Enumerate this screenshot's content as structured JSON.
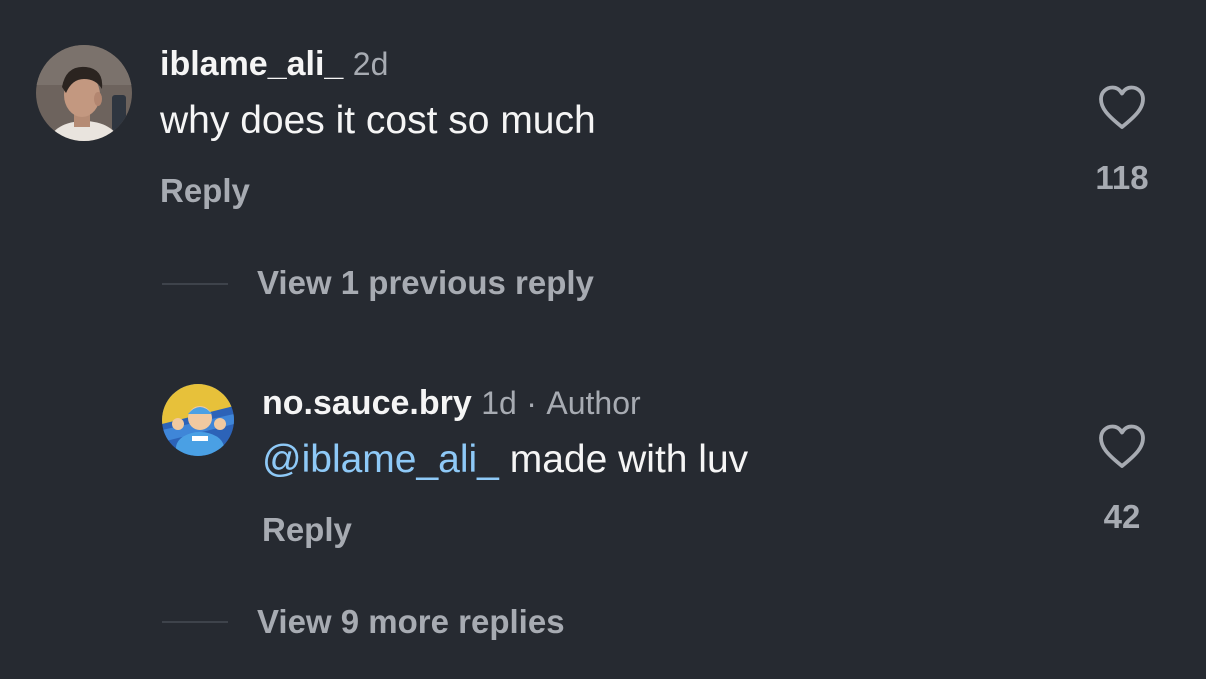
{
  "comments": [
    {
      "username": "iblame_ali_",
      "time": "2d",
      "text": "why does it cost so much",
      "reply_label": "Reply",
      "likes": "118",
      "icons": {
        "avatar": "profile-photo-avatar",
        "like": "heart-outline-icon"
      }
    },
    {
      "username": "no.sauce.bry",
      "time": "1d",
      "separator": "·",
      "badge": "Author",
      "mention": "@iblame_ali_",
      "text": " made with luv",
      "reply_label": "Reply",
      "likes": "42",
      "icons": {
        "avatar": "cartoon-avatar",
        "like": "heart-outline-icon"
      }
    }
  ],
  "view_previous_replies": "View 1 previous reply",
  "view_more_replies": "View 9 more replies",
  "colors": {
    "background": "#262a31",
    "primary_text": "#f5f5f5",
    "secondary_text": "#a7abb2",
    "mention": "#8ec9f7"
  }
}
